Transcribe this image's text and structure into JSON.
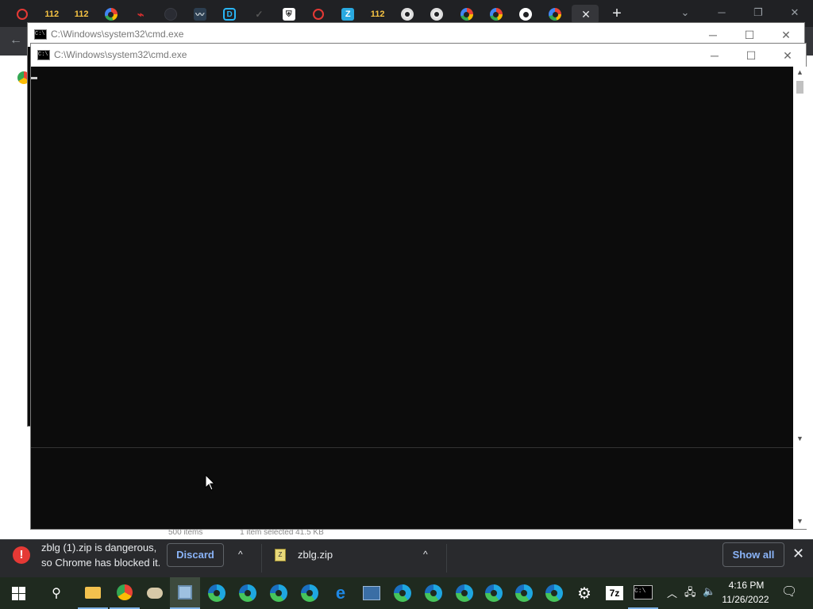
{
  "chrome": {
    "tabs": [
      {
        "icon": "quora-icon",
        "glyph": ""
      },
      {
        "icon": "112-icon",
        "glyph": "112"
      },
      {
        "icon": "112-icon",
        "glyph": "112"
      },
      {
        "icon": "google-icon",
        "glyph": ""
      },
      {
        "icon": "red-swoosh-icon",
        "glyph": "⌁"
      },
      {
        "icon": "dark-site-icon",
        "glyph": ""
      },
      {
        "icon": "wave-icon",
        "glyph": "〰"
      },
      {
        "icon": "d-logo-icon",
        "glyph": "D"
      },
      {
        "icon": "checkmark-icon",
        "glyph": "✓"
      },
      {
        "icon": "shield-icon",
        "glyph": "⛨"
      },
      {
        "icon": "quora-icon",
        "glyph": ""
      },
      {
        "icon": "zm-icon",
        "glyph": "Z"
      },
      {
        "icon": "112-icon",
        "glyph": "112"
      },
      {
        "icon": "chrome-icon",
        "glyph": ""
      },
      {
        "icon": "chrome-icon",
        "glyph": ""
      },
      {
        "icon": "google-icon",
        "glyph": ""
      },
      {
        "icon": "google-icon",
        "glyph": ""
      },
      {
        "icon": "globe-icon",
        "glyph": ""
      },
      {
        "icon": "google-icon",
        "glyph": ""
      }
    ],
    "new_tab_label": "+",
    "active_tab_close": "✕",
    "window_controls": {
      "minimize": "─",
      "restore": "❐",
      "close": "✕",
      "dropdown": "⌄"
    }
  },
  "cmd_back": {
    "title": "C:\\Windows\\system32\\cmd.exe",
    "controls": {
      "minimize": "─",
      "maximize": "☐",
      "close": "✕"
    }
  },
  "cmd_front": {
    "title": "C:\\Windows\\system32\\cmd.exe",
    "controls": {
      "minimize": "─",
      "maximize": "☐",
      "close": "✕"
    }
  },
  "explorer_status": {
    "items": "500 items",
    "selected": "1 item selected 41.5 KB"
  },
  "download_bar": {
    "warning_line1": "zblg (1).zip is dangerous,",
    "warning_line2": "so Chrome has blocked it.",
    "discard_label": "Discard",
    "file_name": "zblg.zip",
    "show_all_label": "Show all",
    "close": "✕",
    "caret": "^"
  },
  "taskbar": {
    "clock_time": "4:16 PM",
    "clock_date": "11/26/2022",
    "sevenzip_label": "7z"
  },
  "colors": {
    "chrome_dark": "#202124",
    "cmd_background": "#0c0c0c",
    "link_blue": "#8ab4f8",
    "danger_red": "#e53935"
  }
}
